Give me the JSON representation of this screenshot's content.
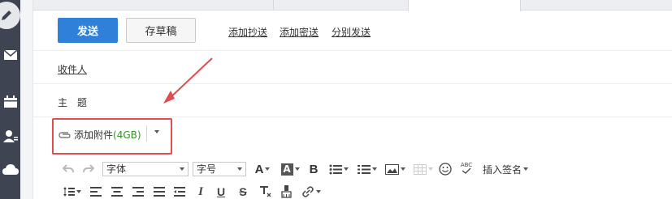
{
  "actions": {
    "send_label": "发送",
    "draft_label": "存草稿",
    "add_cc": "添加抄送",
    "add_bcc": "添加密送",
    "separate_send": "分别发送"
  },
  "fields": {
    "recipient_label": "收件人",
    "subject_label": "主　题"
  },
  "attachment": {
    "label": "添加附件",
    "size": "(4GB)"
  },
  "toolbar": {
    "font_select": "字体",
    "size_select": "字号",
    "insert_signature": "插入签名",
    "abc": "ABC"
  },
  "sidebar": {
    "icons": [
      "pencil-icon",
      "mail-icon",
      "calendar-icon",
      "contacts-icon",
      "cloud-icon"
    ]
  },
  "colors": {
    "send_button": "#2f80d8",
    "annotation": "#e14c4c",
    "sidebar": "#3e4452",
    "attachment_size": "#3a8f2a"
  }
}
